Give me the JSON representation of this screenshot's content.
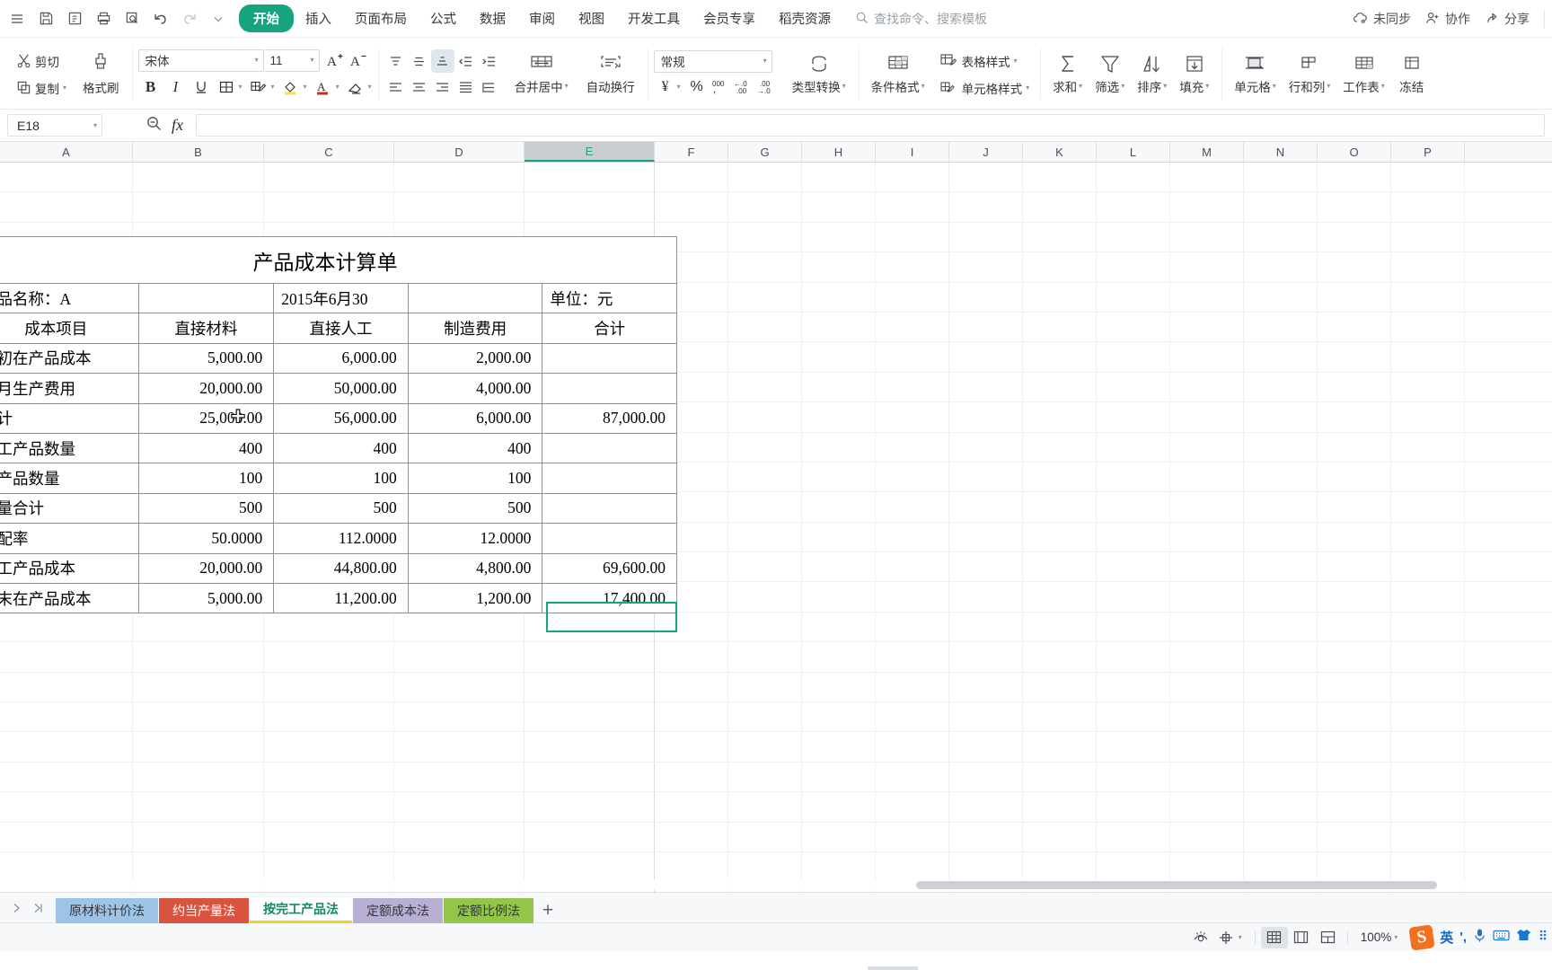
{
  "topbar": {
    "quick_access": [
      {
        "name": "save-icon",
        "glyph": "save"
      },
      {
        "name": "save-as-icon",
        "glyph": "saveas"
      },
      {
        "name": "print-icon",
        "glyph": "print"
      },
      {
        "name": "print-preview-icon",
        "glyph": "preview"
      },
      {
        "name": "undo-icon",
        "glyph": "undo"
      },
      {
        "name": "redo-icon",
        "glyph": "redo"
      },
      {
        "name": "customize-qat-icon",
        "glyph": "chevron"
      }
    ],
    "menus": [
      {
        "label": "开始",
        "active": true
      },
      {
        "label": "插入",
        "active": false
      },
      {
        "label": "页面布局",
        "active": false
      },
      {
        "label": "公式",
        "active": false
      },
      {
        "label": "数据",
        "active": false
      },
      {
        "label": "审阅",
        "active": false
      },
      {
        "label": "视图",
        "active": false
      },
      {
        "label": "开发工具",
        "active": false
      },
      {
        "label": "会员专享",
        "active": false
      },
      {
        "label": "稻壳资源",
        "active": false
      }
    ],
    "search_placeholder": "查找命令、搜索模板",
    "right_items": [
      {
        "label": "未同步",
        "icon": "cloud-sync-icon"
      },
      {
        "label": "协作",
        "icon": "collaborate-icon"
      },
      {
        "label": "分享",
        "icon": "share-icon"
      }
    ]
  },
  "ribbon": {
    "clipboard": {
      "cut": "剪切",
      "copy": "复制",
      "format_painter": "格式刷"
    },
    "font": {
      "family": "宋体",
      "size": "11",
      "grow": "A+",
      "shrink": "A-",
      "bold": "B",
      "italic": "I",
      "underline": "U",
      "borders": "边框",
      "pen": "绘图边框",
      "fill_color": "填充颜色",
      "font_color": "字体颜色",
      "clear_format": "清除格式"
    },
    "alignment": {
      "align_top": "顶端对齐",
      "align_middle": "垂直居中",
      "align_bottom": "底端对齐",
      "decrease_indent": "减少缩进",
      "increase_indent": "增加缩进",
      "align_left": "左对齐",
      "align_center": "居中",
      "align_right": "右对齐",
      "justify": "两端对齐",
      "distribute": "分散对齐",
      "merge_center": "合并居中",
      "wrap_text": "自动换行"
    },
    "number": {
      "format": "常规",
      "currency": "¥",
      "percent": "%",
      "comma": "000,",
      "increase_decimal": "←.0 .00",
      "decrease_decimal": ".00 →.0",
      "type_convert": "类型转换"
    },
    "styles": {
      "conditional_format": "条件格式",
      "table_style": "表格样式",
      "cell_style": "单元格样式"
    },
    "editing": {
      "sum": "求和",
      "filter": "筛选",
      "sort": "排序",
      "fill": "填充"
    },
    "cells": {
      "cell": "单元格",
      "rows_cols": "行和列",
      "worksheet": "工作表",
      "freeze": "冻结"
    }
  },
  "formula_bar": {
    "name_box": "E18",
    "formula": "",
    "zoom_icon": "zoom-out-icon",
    "fx": "fx"
  },
  "grid": {
    "columns": [
      "A",
      "B",
      "C",
      "D",
      "E",
      "F",
      "G",
      "H",
      "I",
      "J",
      "K",
      "L",
      "M",
      "N",
      "O",
      "P"
    ],
    "selected_column": "E",
    "selected_cell": "E18"
  },
  "report": {
    "title": "产品成本计算单",
    "info_row": {
      "product_label": "产品名称：A",
      "date": "2015年6月30",
      "unit": "单位：元"
    },
    "headers": [
      "成本项目",
      "直接材料",
      "直接人工",
      "制造费用",
      "合计"
    ],
    "rows": [
      {
        "label": "月初在产品成本",
        "values": [
          "5,000.00",
          "6,000.00",
          "2,000.00",
          ""
        ]
      },
      {
        "label": "本月生产费用",
        "values": [
          "20,000.00",
          "50,000.00",
          "4,000.00",
          ""
        ]
      },
      {
        "label": "合计",
        "values": [
          "25,000.00",
          "56,000.00",
          "6,000.00",
          "87,000.00"
        ]
      },
      {
        "label": "完工产品数量",
        "values": [
          "400",
          "400",
          "400",
          ""
        ]
      },
      {
        "label": "在产品数量",
        "values": [
          "100",
          "100",
          "100",
          ""
        ]
      },
      {
        "label": "数量合计",
        "values": [
          "500",
          "500",
          "500",
          ""
        ]
      },
      {
        "label": "分配率",
        "values": [
          "50.0000",
          "112.0000",
          "12.0000",
          ""
        ]
      },
      {
        "label": "完工产品成本",
        "values": [
          "20,000.00",
          "44,800.00",
          "4,800.00",
          "69,600.00"
        ]
      },
      {
        "label": "月末在产品成本",
        "values": [
          "5,000.00",
          "11,200.00",
          "1,200.00",
          "17,400.00"
        ]
      }
    ]
  },
  "sheet_tabs": {
    "prev_label": "上一张",
    "next_label": "下一张",
    "tabs": [
      {
        "label": "原材料计价法",
        "color": "#9dc3e6",
        "active": false
      },
      {
        "label": "约当产量法",
        "color": "#d9543f",
        "active": false
      },
      {
        "label": "按完工产品法",
        "color": "#ffffff",
        "active": true
      },
      {
        "label": "定额成本法",
        "color": "#b9aed4",
        "active": false
      },
      {
        "label": "定额比例法",
        "color": "#92c54a",
        "active": false
      }
    ],
    "add_label": "+"
  },
  "status_bar": {
    "eye_icon": "eye-protection-icon",
    "move_icon": "move-mode-icon",
    "views": [
      {
        "name": "normal-view",
        "active": true
      },
      {
        "name": "page-layout-view",
        "active": false
      },
      {
        "name": "page-break-view",
        "active": false
      }
    ],
    "zoom": "100%",
    "ime": {
      "logo": "S",
      "mode": "英",
      "punctuation": "',",
      "mic": "mic-icon",
      "keyboard": "keyboard-icon",
      "skin": "skin-icon",
      "more": "more-icon"
    }
  },
  "colors": {
    "accent": "#16a37f",
    "tab_underline": "#f2d024",
    "selected_header": "#c9ccd0"
  }
}
